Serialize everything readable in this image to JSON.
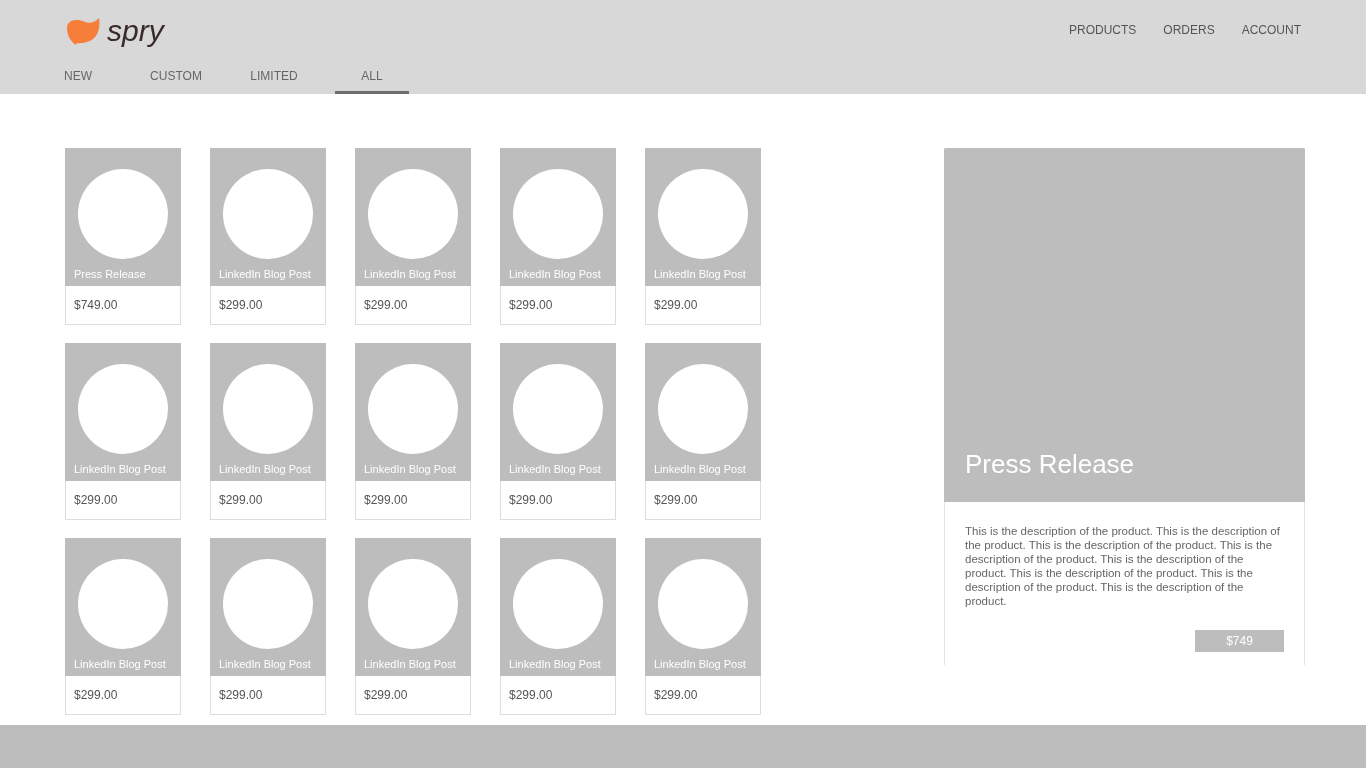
{
  "logo": {
    "text": "spry"
  },
  "nav": [
    "PRODUCTS",
    "ORDERS",
    "ACCOUNT"
  ],
  "tabs": [
    {
      "label": "NEW",
      "selected": false
    },
    {
      "label": "CUSTOM",
      "selected": false
    },
    {
      "label": "LIMITED",
      "selected": false
    },
    {
      "label": "ALL",
      "selected": true
    }
  ],
  "products": [
    {
      "name": "Press Release",
      "price": "$749.00"
    },
    {
      "name": "LinkedIn Blog Post",
      "price": "$299.00"
    },
    {
      "name": "LinkedIn Blog Post",
      "price": "$299.00"
    },
    {
      "name": "LinkedIn Blog Post",
      "price": "$299.00"
    },
    {
      "name": "LinkedIn Blog Post",
      "price": "$299.00"
    },
    {
      "name": "LinkedIn Blog Post",
      "price": "$299.00"
    },
    {
      "name": "LinkedIn Blog Post",
      "price": "$299.00"
    },
    {
      "name": "LinkedIn Blog Post",
      "price": "$299.00"
    },
    {
      "name": "LinkedIn Blog Post",
      "price": "$299.00"
    },
    {
      "name": "LinkedIn Blog Post",
      "price": "$299.00"
    },
    {
      "name": "LinkedIn Blog Post",
      "price": "$299.00"
    },
    {
      "name": "LinkedIn Blog Post",
      "price": "$299.00"
    },
    {
      "name": "LinkedIn Blog Post",
      "price": "$299.00"
    },
    {
      "name": "LinkedIn Blog Post",
      "price": "$299.00"
    },
    {
      "name": "LinkedIn Blog Post",
      "price": "$299.00"
    }
  ],
  "detail": {
    "title": "Press Release",
    "description": "This is the description of the product. This is the description of the product. This is the description of the product. This is the description of the product. This is the description of the product. This is the description of the product. This is the description of the product. This is the description of the product.",
    "price_button": "$749"
  }
}
